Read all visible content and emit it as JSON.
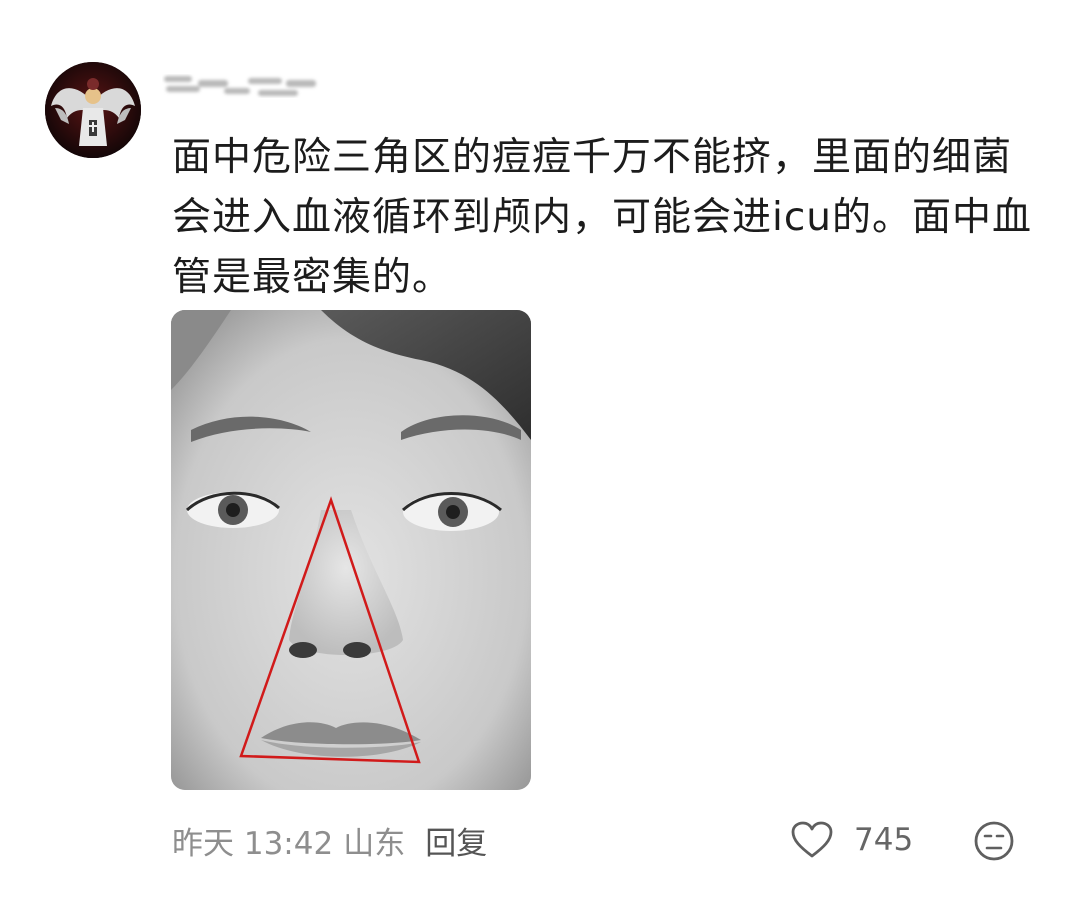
{
  "comment": {
    "text": "面中危险三角区的痘痘千万不能挤，里面的细菌会进入血液循环到颅内，可能会进icu的。面中血管是最密集的。",
    "image": {
      "annotation_color": "#d11a1a"
    },
    "meta": {
      "time": "昨天 13:42",
      "location": "山东",
      "reply_label": "回复"
    },
    "like_count": "745",
    "icons": {
      "like": "heart-outline-icon",
      "emoji": "meh-face-icon"
    }
  }
}
